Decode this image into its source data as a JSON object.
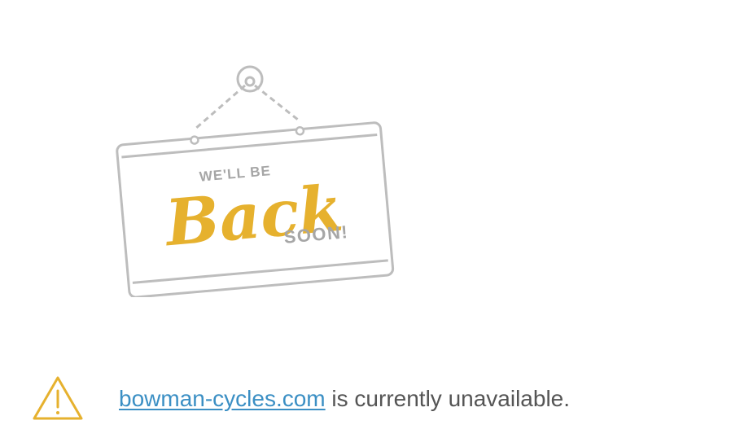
{
  "sign": {
    "top_text": "WE'LL BE",
    "main_text": "Back",
    "bottom_text": "SOON!"
  },
  "notice": {
    "domain_link": "bowman-cycles.com",
    "suffix": " is currently unavailable."
  },
  "colors": {
    "sign_outline": "#bdbdbd",
    "sign_text_gray": "#a6a6a6",
    "accent_gold": "#e6b12e",
    "link_blue": "#3b8fc4",
    "body_text": "#555555"
  },
  "icons": {
    "warning": "warning-triangle-icon"
  }
}
